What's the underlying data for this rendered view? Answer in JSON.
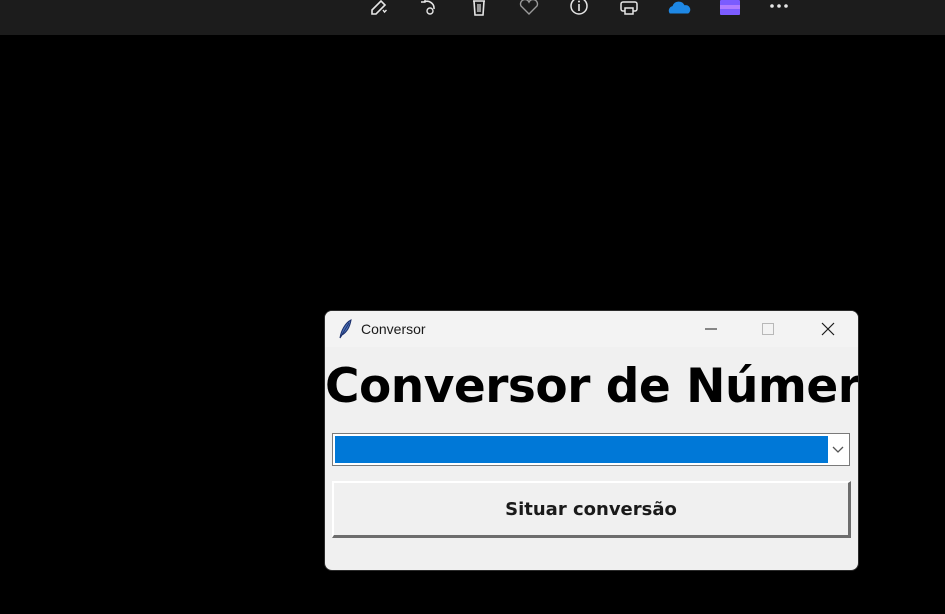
{
  "viewer_toolbar": {
    "icons": [
      "edit-icon",
      "rotate-icon",
      "delete-icon",
      "favorite-icon",
      "info-icon",
      "print-icon",
      "onedrive-icon",
      "clipchamp-icon",
      "more-icon"
    ]
  },
  "window": {
    "title": "Conversor",
    "heading": "Conversor de Números",
    "combo_value": "",
    "button_label": "Situar conversão"
  },
  "colors": {
    "selection": "#0078d7",
    "window_bg": "#f0f0f0",
    "toolbar_bg": "#1c1c1c"
  }
}
